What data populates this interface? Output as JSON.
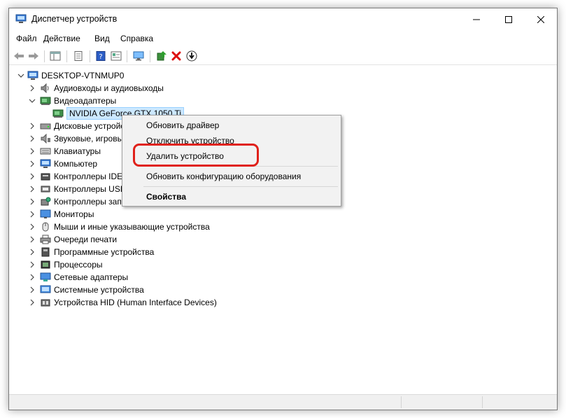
{
  "window": {
    "title": "Диспетчер устройств"
  },
  "menu": [
    "Файл",
    "Действие",
    "Вид",
    "Справка"
  ],
  "tree": {
    "root": "DESKTOP-VTNMUP0",
    "items": [
      {
        "label": "Аудиовходы и аудиовыходы",
        "icon": "speaker-icon"
      },
      {
        "label": "Видеоадаптеры",
        "icon": "display-adapter-icon",
        "expanded": true
      },
      {
        "label": "NVIDIA GeForce GTX 1050 Ti",
        "icon": "display-adapter-icon",
        "child": true,
        "selected": true
      },
      {
        "label": "Дисковые устройства",
        "icon": "disk-drive-icon"
      },
      {
        "label": "Звуковые, игровые и видеоустройства",
        "icon": "sound-icon"
      },
      {
        "label": "Клавиатуры",
        "icon": "keyboard-icon"
      },
      {
        "label": "Компьютер",
        "icon": "computer-icon"
      },
      {
        "label": "Контроллеры IDE ATA/ATAPI",
        "icon": "ide-controller-icon"
      },
      {
        "label": "Контроллеры USB",
        "icon": "usb-controller-icon"
      },
      {
        "label": "Контроллеры запоминающих устройств",
        "icon": "storage-controller-icon"
      },
      {
        "label": "Мониторы",
        "icon": "monitor-icon"
      },
      {
        "label": "Мыши и иные указывающие устройства",
        "icon": "mouse-icon"
      },
      {
        "label": "Очереди печати",
        "icon": "printer-icon"
      },
      {
        "label": "Программные устройства",
        "icon": "software-device-icon"
      },
      {
        "label": "Процессоры",
        "icon": "processor-icon"
      },
      {
        "label": "Сетевые адаптеры",
        "icon": "network-adapter-icon"
      },
      {
        "label": "Системные устройства",
        "icon": "system-device-icon"
      },
      {
        "label": "Устройства HID (Human Interface Devices)",
        "icon": "hid-icon"
      }
    ]
  },
  "context_menu": {
    "update_driver": "Обновить драйвер",
    "disable_device": "Отключить устройство",
    "uninstall_device": "Удалить устройство",
    "scan_hardware": "Обновить конфигурацию оборудования",
    "properties": "Свойства"
  },
  "colors": {
    "highlight": "#e0211a",
    "selection": "#cce8ff",
    "accent": "#0078d7"
  }
}
